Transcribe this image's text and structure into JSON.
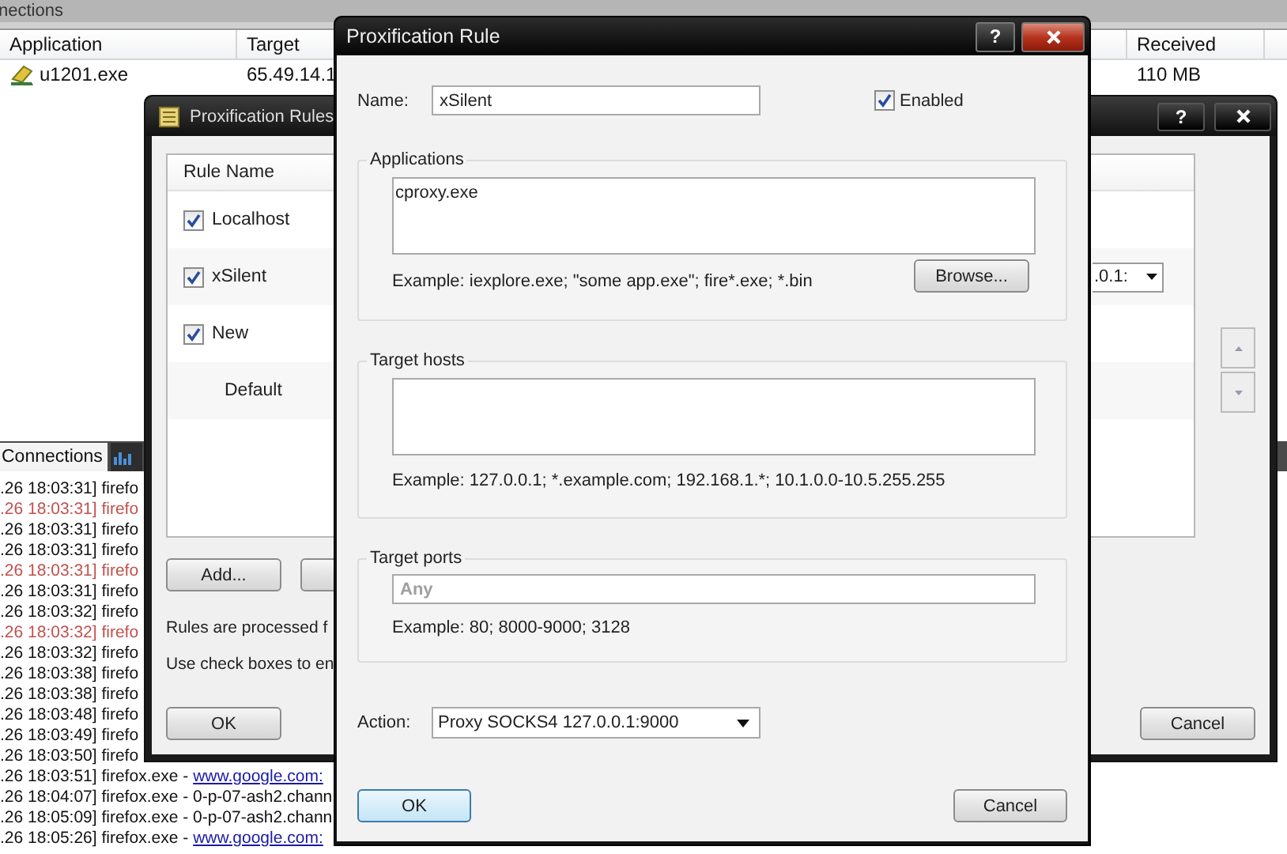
{
  "main_window": {
    "title": "nections",
    "columns": [
      "Application",
      "Target",
      "Received"
    ],
    "rows": [
      {
        "application": "u1201.exe",
        "target": "65.49.14.1",
        "received": "110 MB"
      }
    ],
    "tabs": [
      {
        "kind": "text",
        "label": "Connections",
        "selected": true
      },
      {
        "kind": "icon",
        "selected": false
      }
    ],
    "log": [
      {
        "text": ".26 18:03:31] firefo",
        "error": false
      },
      {
        "text": ".26 18:03:31] firefo",
        "error": true
      },
      {
        "text": ".26 18:03:31] firefo",
        "error": false
      },
      {
        "text": ".26 18:03:31] firefo",
        "error": false
      },
      {
        "text": ".26 18:03:31] firefo",
        "error": true
      },
      {
        "text": ".26 18:03:31] firefo",
        "error": false
      },
      {
        "text": ".26 18:03:32] firefo",
        "error": false
      },
      {
        "text": ".26 18:03:32] firefo",
        "error": true
      },
      {
        "text": ".26 18:03:32] firefo",
        "error": false
      },
      {
        "text": ".26 18:03:38] firefo",
        "error": false
      },
      {
        "text": ".26 18:03:38] firefo",
        "error": false
      },
      {
        "text": ".26 18:03:48] firefo",
        "error": false
      },
      {
        "text": ".26 18:03:49] firefo",
        "error": false
      },
      {
        "text": ".26 18:03:50] firefo",
        "error": false
      },
      {
        "text": ".26 18:03:51] firefox.exe -",
        "link": "www.google.com:",
        "error": false
      },
      {
        "text": ".26 18:04:07] firefox.exe - 0-p-07-ash2.chann",
        "error": false
      },
      {
        "text": ".26 18:05:09] firefox.exe - 0-p-07-ash2.chann",
        "error": false
      },
      {
        "text": ".26 18:05:26] firefox.exe -",
        "link": "www.google.com:",
        "error": false
      }
    ]
  },
  "rules_window": {
    "title": "Proxification Rules",
    "help": "?",
    "list_header": "Rule Name",
    "rules": [
      {
        "kind": "checkbox",
        "name": "Localhost",
        "checked": true
      },
      {
        "kind": "checkbox",
        "name": "xSilent",
        "checked": true,
        "action": ".0.1:"
      },
      {
        "kind": "checkbox",
        "name": "New",
        "checked": true
      },
      {
        "kind": "plain",
        "name": "Default"
      }
    ],
    "add_button": "Add...",
    "notes": [
      "Rules are processed f",
      "Use check boxes to en"
    ],
    "ok": "OK",
    "cancel": "Cancel"
  },
  "dialog": {
    "title": "Proxification Rule",
    "help": "?",
    "name_label": "Name:",
    "name_value": "xSilent",
    "enabled": {
      "label": "Enabled",
      "checked": true
    },
    "groups": [
      {
        "kind": "textarea",
        "title": "Applications",
        "value": "cproxy.exe",
        "example": "Example: iexplore.exe; \"some app.exe\"; fire*.exe; *.bin",
        "button": "Browse..."
      },
      {
        "kind": "textarea",
        "title": "Target hosts",
        "example": "Example: 127.0.0.1; *.example.com; 192.168.1.*; 10.1.0.0-10.5.255.255"
      },
      {
        "kind": "input",
        "title": "Target ports",
        "placeholder": "Any",
        "example": "Example: 80; 8000-9000; 3128"
      }
    ],
    "action_label": "Action:",
    "action_value": "Proxy SOCKS4 127.0.0.1:9000",
    "ok": "OK",
    "cancel": "Cancel"
  }
}
